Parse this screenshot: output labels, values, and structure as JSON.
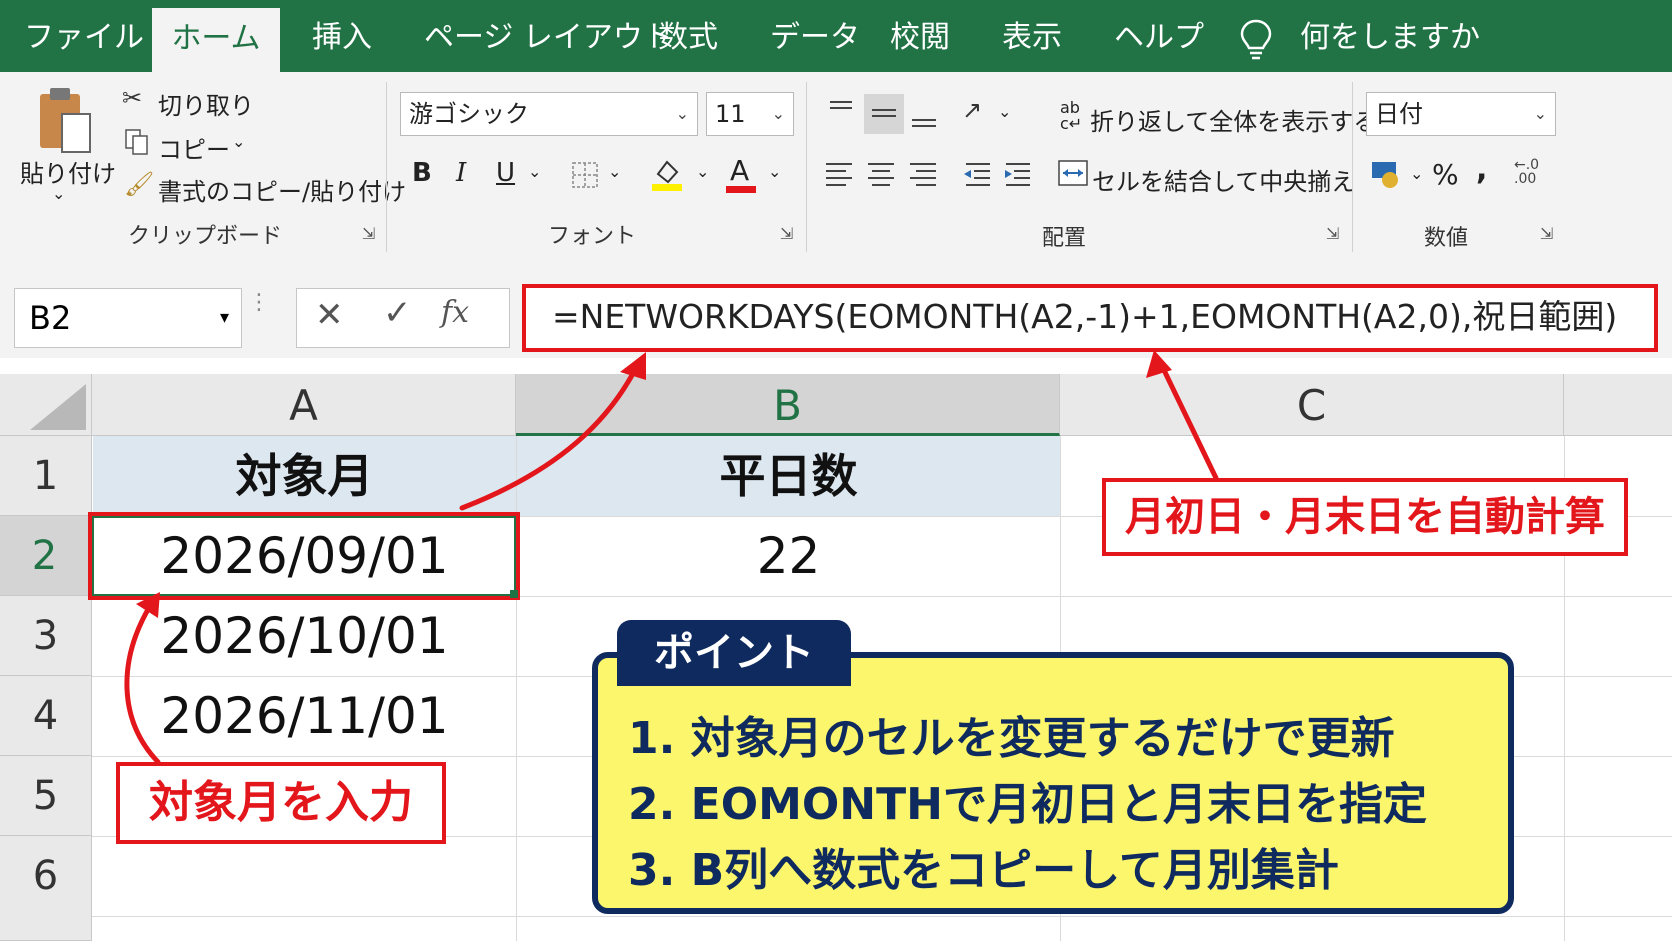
{
  "tabs": [
    "ファイル",
    "ホーム",
    "挿入",
    "ページ レイアウト",
    "数式",
    "データ",
    "校閲",
    "表示",
    "ヘルプ"
  ],
  "active_tab": "ホーム",
  "tell_me": "何をしますか",
  "ribbon": {
    "clipboard": {
      "paste": "貼り付け",
      "cut": "切り取り",
      "copy": "コピー",
      "format_painter": "書式のコピー/貼り付け",
      "group": "クリップボード"
    },
    "font": {
      "name": "游ゴシック",
      "size": "11",
      "bold": "B",
      "italic": "I",
      "underline": "U",
      "font_color_glyph": "A",
      "group": "フォント"
    },
    "alignment": {
      "wrap": "折り返して全体を表示する",
      "merge": "セルを結合して中央揃え",
      "group": "配置"
    },
    "number": {
      "format": "日付",
      "percent": "%",
      "comma": ",",
      "group": "数値"
    }
  },
  "formula_bar": {
    "name_box": "B2",
    "formula": "=NETWORKDAYS(EOMONTH(A2,-1)+1,EOMONTH(A2,0),祝日範囲)"
  },
  "sheet": {
    "columns": [
      "A",
      "B",
      "C"
    ],
    "rows": [
      "1",
      "2",
      "3",
      "4",
      "5",
      "6"
    ],
    "headers": [
      "対象月",
      "平日数"
    ],
    "data": [
      {
        "a": "2026/09/01",
        "b": "22"
      },
      {
        "a": "2026/10/01",
        "b": ""
      },
      {
        "a": "2026/11/01",
        "b": ""
      }
    ]
  },
  "annotations": {
    "callout_auto": "月初日・月末日を自動計算",
    "callout_input": "対象月を入力",
    "point_title": "ポイント",
    "points": [
      "1. 対象月のセルを変更するだけで更新",
      "2. EOMONTHで月初日と月末日を指定",
      "3. B列へ数式をコピーして月別集計"
    ]
  },
  "colors": {
    "excel_green": "#217346",
    "callout_red": "#e3161b",
    "point_navy": "#0f2a5e",
    "point_yellow": "#fbf66b"
  }
}
